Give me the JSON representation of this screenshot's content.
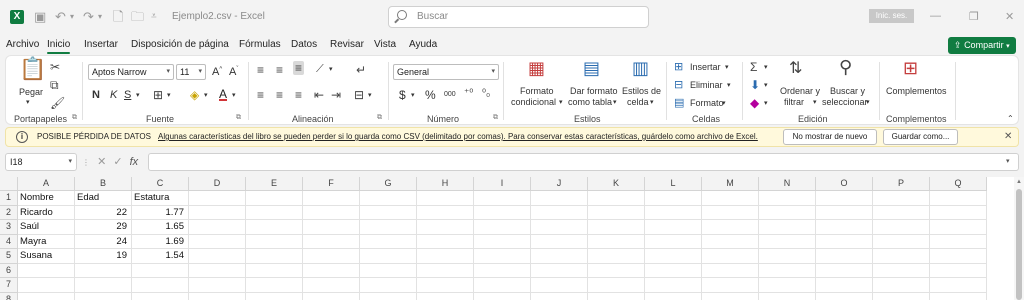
{
  "titlebar": {
    "app_logo": "X",
    "title": "Ejemplo2.csv  -  Excel",
    "search_placeholder": "Buscar",
    "signin": "Inic. ses.",
    "minimize": "—",
    "restore": "❐",
    "close": "✕"
  },
  "tabs": [
    "Archivo",
    "Inicio",
    "Insertar",
    "Disposición de página",
    "Fórmulas",
    "Datos",
    "Revisar",
    "Vista",
    "Ayuda"
  ],
  "share_label": "Compartir",
  "ribbon": {
    "clipboard": {
      "paste": "Pegar",
      "group": "Portapapeles"
    },
    "font": {
      "name": "Aptos Narrow",
      "size": "11",
      "grow": "A^",
      "shrink": "Aˇ",
      "bold": "N",
      "italic": "K",
      "underline": "S",
      "group": "Fuente"
    },
    "alignment": {
      "group": "Alineación"
    },
    "number": {
      "format": "General",
      "currency": "$",
      "percent": "%",
      "thousands": "000",
      "group": "Número"
    },
    "styles": {
      "conditional": [
        "Formato",
        "condicional"
      ],
      "as_table": [
        "Dar formato",
        "como tabla"
      ],
      "cell_styles": [
        "Estilos de",
        "celda"
      ],
      "group": "Estilos"
    },
    "cells": {
      "insert": "Insertar",
      "delete": "Eliminar",
      "format": "Formato",
      "group": "Celdas"
    },
    "editing": {
      "sort": [
        "Ordenar y",
        "filtrar"
      ],
      "find": [
        "Buscar y",
        "seleccionar"
      ],
      "group": "Edición"
    },
    "addins": {
      "label": "Complementos",
      "group": "Complementos"
    }
  },
  "infobar": {
    "title": "POSIBLE PÉRDIDA DE DATOS",
    "message": "Algunas características del libro se pueden perder si lo guarda como CSV (delimitado por comas). Para conservar estas características, guárdelo como archivo de Excel.",
    "btn_dismiss": "No mostrar de nuevo",
    "btn_save": "Guardar como..."
  },
  "formula_bar": {
    "name_box": "I18",
    "fx": "fx",
    "value": ""
  },
  "grid": {
    "columns": [
      "A",
      "B",
      "C",
      "D",
      "E",
      "F",
      "G",
      "H",
      "I",
      "J",
      "K",
      "L",
      "M",
      "N",
      "O",
      "P",
      "Q"
    ],
    "rows": [
      "1",
      "2",
      "3",
      "4",
      "5",
      "6",
      "7",
      "8"
    ],
    "cells": [
      [
        "Nombre",
        "Edad",
        "Estatura"
      ],
      [
        "Ricardo",
        "22",
        "1.77"
      ],
      [
        "Saúl",
        "29",
        "1.65"
      ],
      [
        "Mayra",
        "24",
        "1.69"
      ],
      [
        "Susana",
        "19",
        "1.54"
      ]
    ]
  }
}
